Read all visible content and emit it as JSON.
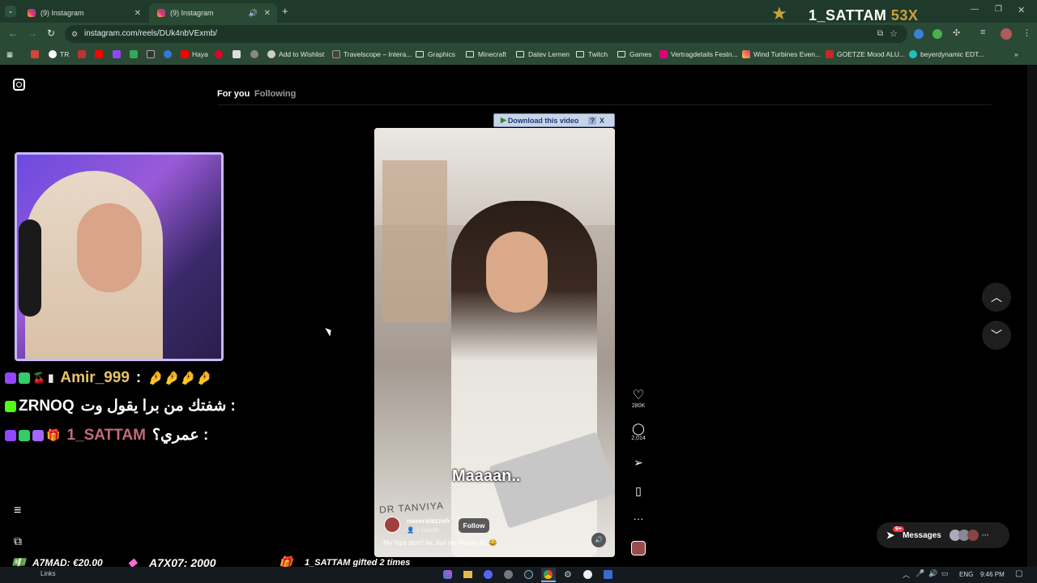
{
  "tabs": [
    {
      "title": "(9) Instagram",
      "active": false
    },
    {
      "title": "(9) Instagram",
      "active": true
    }
  ],
  "overlay_top": {
    "name": "1_SATTAM",
    "count": "53X"
  },
  "address_bar": {
    "url": "instagram.com/reels/DUk4nbVExmb/"
  },
  "bookmarks": [
    {
      "label": "TR",
      "icon": "google-icon"
    },
    {
      "label": "Haya",
      "icon": "youtube-icon"
    },
    {
      "label": "Add to Wishlist",
      "icon": "wishlist-icon"
    },
    {
      "label": "Travelscope – Intera...",
      "icon": "travelscope-icon"
    },
    {
      "label": "Graphics",
      "icon": "folder-icon"
    },
    {
      "label": "Minecraft",
      "icon": "folder-icon"
    },
    {
      "label": "Datev Lernen",
      "icon": "folder-icon"
    },
    {
      "label": "Twitch",
      "icon": "folder-icon"
    },
    {
      "label": "Games",
      "icon": "folder-icon"
    },
    {
      "label": "Vertragdetails Festn...",
      "icon": "telekom-icon"
    },
    {
      "label": "Wind Turbines Even...",
      "icon": "instagram-icon"
    },
    {
      "label": "GOETZE Mood ALU...",
      "icon": "goetze-icon"
    },
    {
      "label": "beyerdynamic EDT...",
      "icon": "beyerdynamic-icon"
    }
  ],
  "feed": {
    "tab_for_you": "For you",
    "tab_following": "Following"
  },
  "download_bar": {
    "label": "Download this video",
    "help": "?",
    "close": "X"
  },
  "video": {
    "caption_overlay": "Maaaan..",
    "author": "naseralazzeh",
    "people": "3 people",
    "follow": "Follow",
    "description": "My hips don't lie, but my knees do 😂",
    "coat_text": "DR TANVIYA"
  },
  "actions": {
    "likes": "280K",
    "comments": "2,014"
  },
  "messages": {
    "label": "Messages",
    "badge": "9+"
  },
  "chat": [
    {
      "user": "Amir_999",
      "message": ":",
      "color": "#e9c46a"
    },
    {
      "user": "ZRNOQ",
      "message": "شفتك من برا يقول وت :",
      "color": "#ffffff"
    },
    {
      "user": "1_SATTAM",
      "message": "عمري؟ :",
      "color": "#c46b7a"
    }
  ],
  "ticker": [
    {
      "text": "A7MAD: €20.00"
    },
    {
      "text": "A7X07: 2000"
    },
    {
      "text": "1_SATTAM gifted 2 times"
    }
  ],
  "left_nav": {
    "links_label": "Links"
  },
  "system_tray": {
    "lang": "ENG",
    "time": "9:46 PM"
  },
  "colors": {
    "chrome_green": "#2b4a36",
    "tab_green": "#1f3a2a",
    "frame_purple": "#c8b8ff",
    "follow_bg": "#5a5a5a"
  }
}
